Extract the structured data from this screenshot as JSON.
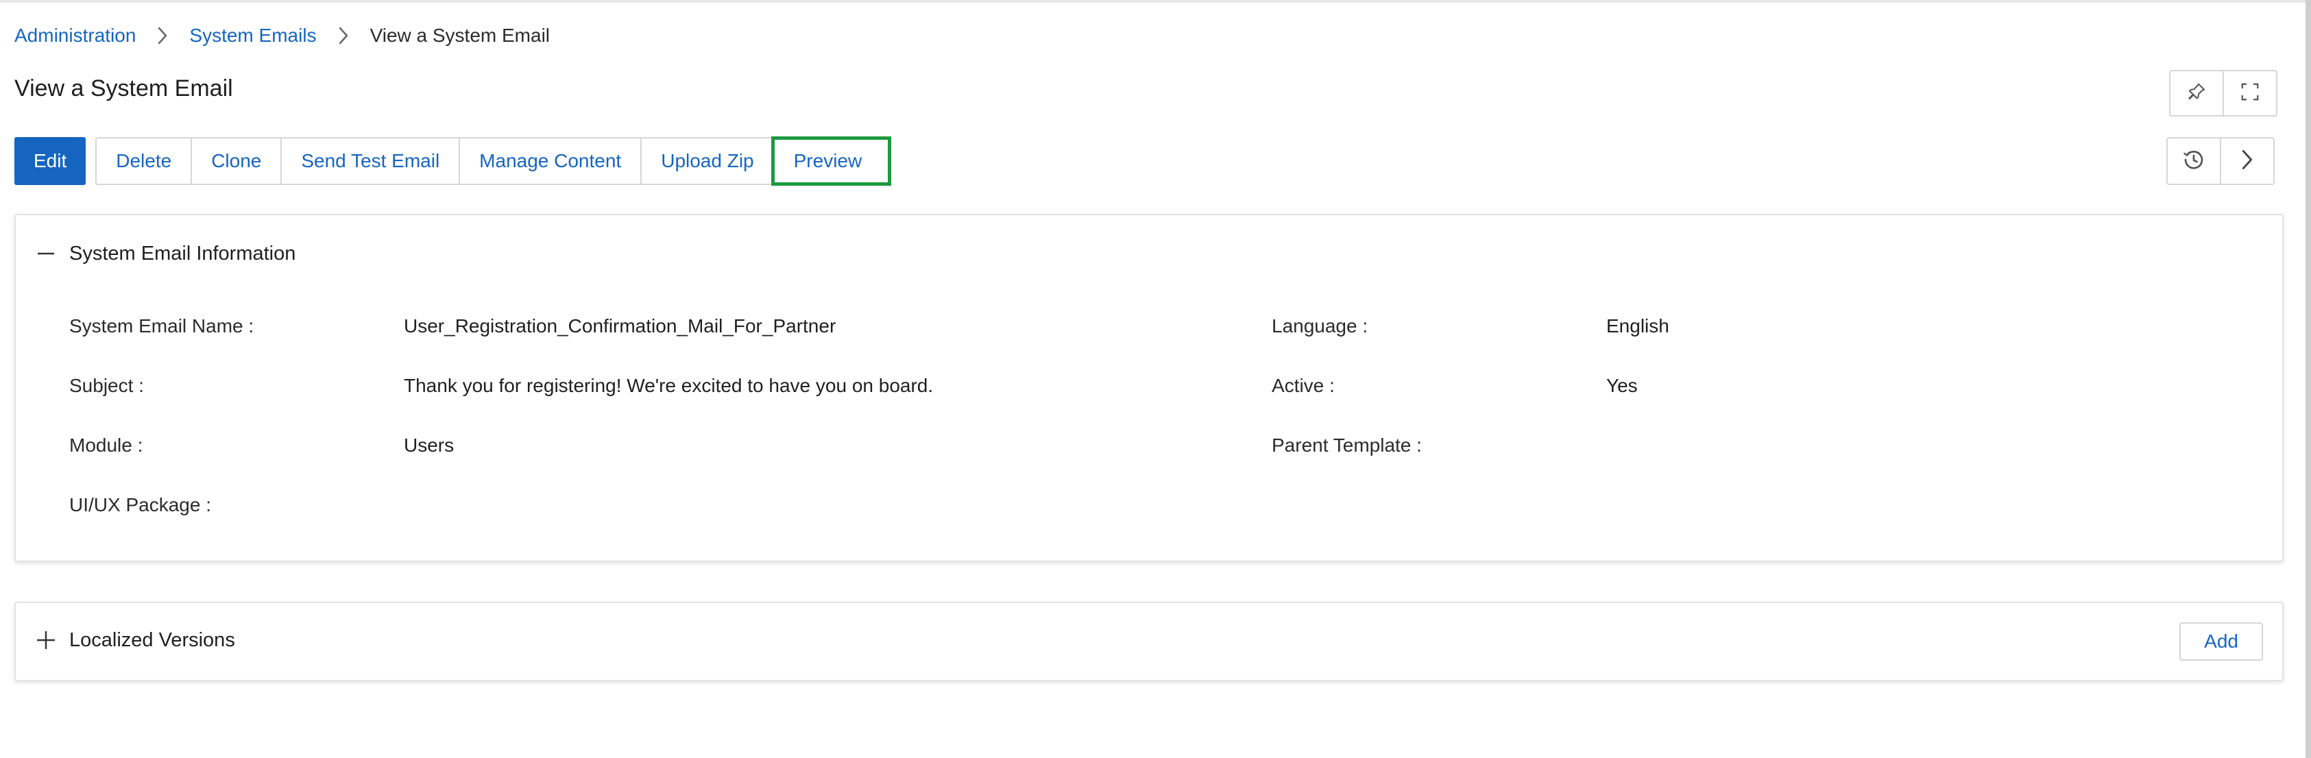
{
  "breadcrumb": {
    "items": [
      {
        "label": "Administration"
      },
      {
        "label": "System Emails"
      },
      {
        "label": "View a System Email"
      }
    ]
  },
  "page": {
    "title": "View a System Email"
  },
  "header_icons": {
    "pin": "pin-icon",
    "fullscreen": "fullscreen-icon",
    "history": "history-icon",
    "next": "chevron-right-icon"
  },
  "toolbar": {
    "edit_label": "Edit",
    "delete_label": "Delete",
    "clone_label": "Clone",
    "send_test_email_label": "Send Test Email",
    "manage_content_label": "Manage Content",
    "upload_zip_label": "Upload Zip",
    "preview_label": "Preview"
  },
  "info_panel": {
    "title": "System Email Information",
    "fields": {
      "name_label": "System Email Name :",
      "name_value": "User_Registration_Confirmation_Mail_For_Partner",
      "subject_label": "Subject :",
      "subject_value": "Thank you for registering! We're excited to have you on board.",
      "module_label": "Module :",
      "module_value": "Users",
      "uiux_label": "UI/UX Package :",
      "language_label": "Language :",
      "language_value": "English",
      "active_label": "Active :",
      "active_value": "Yes",
      "parent_label": "Parent Template :"
    }
  },
  "localized_panel": {
    "title": "Localized Versions",
    "add_label": "Add"
  },
  "colors": {
    "accent": "#1565c0",
    "highlight": "#1c9a3e"
  }
}
